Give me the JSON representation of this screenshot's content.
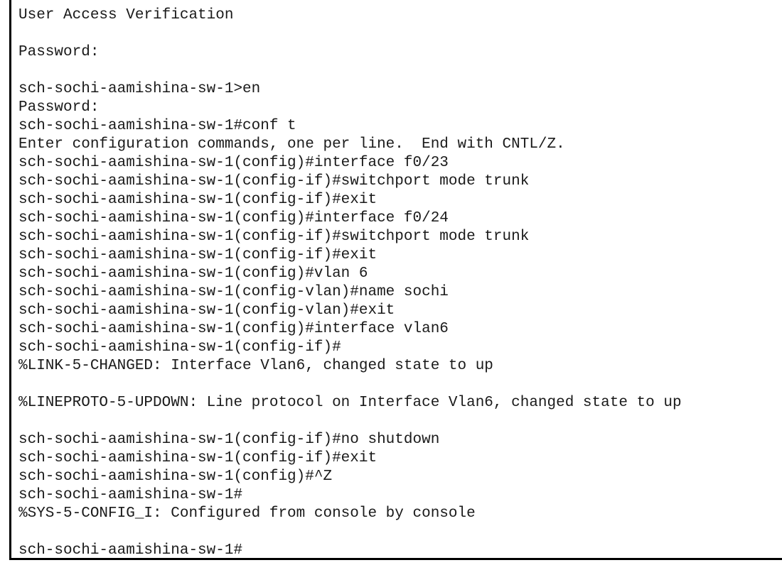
{
  "terminal": {
    "lines": [
      "User Access Verification",
      "",
      "Password:",
      "",
      "sch-sochi-aamishina-sw-1>en",
      "Password:",
      "sch-sochi-aamishina-sw-1#conf t",
      "Enter configuration commands, one per line.  End with CNTL/Z.",
      "sch-sochi-aamishina-sw-1(config)#interface f0/23",
      "sch-sochi-aamishina-sw-1(config-if)#switchport mode trunk",
      "sch-sochi-aamishina-sw-1(config-if)#exit",
      "sch-sochi-aamishina-sw-1(config)#interface f0/24",
      "sch-sochi-aamishina-sw-1(config-if)#switchport mode trunk",
      "sch-sochi-aamishina-sw-1(config-if)#exit",
      "sch-sochi-aamishina-sw-1(config)#vlan 6",
      "sch-sochi-aamishina-sw-1(config-vlan)#name sochi",
      "sch-sochi-aamishina-sw-1(config-vlan)#exit",
      "sch-sochi-aamishina-sw-1(config)#interface vlan6",
      "sch-sochi-aamishina-sw-1(config-if)#",
      "%LINK-5-CHANGED: Interface Vlan6, changed state to up",
      "",
      "%LINEPROTO-5-UPDOWN: Line protocol on Interface Vlan6, changed state to up",
      "",
      "sch-sochi-aamishina-sw-1(config-if)#no shutdown",
      "sch-sochi-aamishina-sw-1(config-if)#exit",
      "sch-sochi-aamishina-sw-1(config)#^Z",
      "sch-sochi-aamishina-sw-1#",
      "%SYS-5-CONFIG_I: Configured from console by console",
      "",
      "sch-sochi-aamishina-sw-1#"
    ]
  }
}
